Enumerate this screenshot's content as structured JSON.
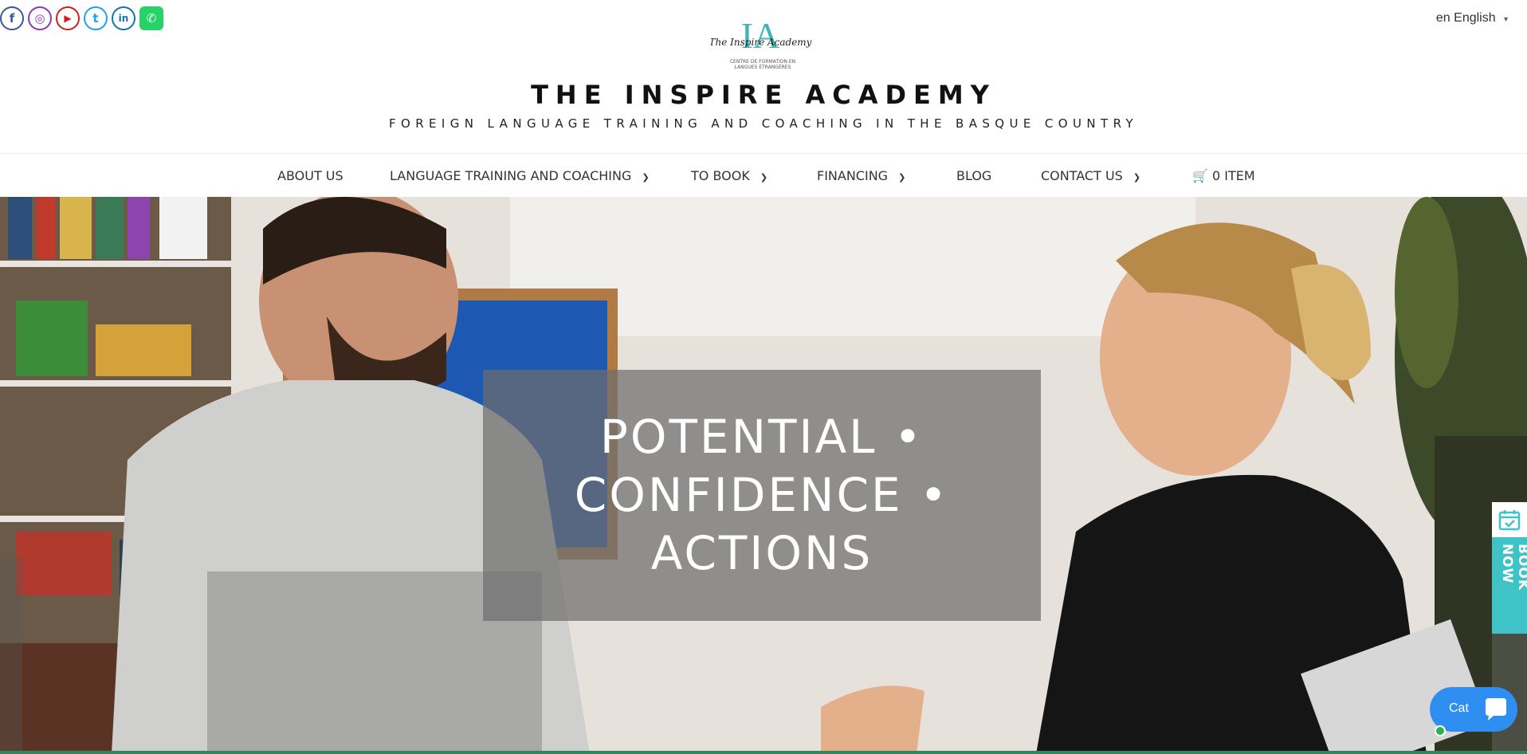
{
  "social": [
    {
      "name": "facebook-icon",
      "glyph": "f"
    },
    {
      "name": "instagram-icon",
      "glyph": "◎"
    },
    {
      "name": "youtube-icon",
      "glyph": "▶"
    },
    {
      "name": "twitter-icon",
      "glyph": "t"
    },
    {
      "name": "linkedin-icon",
      "glyph": "in"
    },
    {
      "name": "whatsapp-icon",
      "glyph": "✆"
    }
  ],
  "language": {
    "code": "en",
    "label": "English"
  },
  "logo": {
    "monogram": "IA",
    "script": "The Inspire Academy",
    "sub_line1": "CENTRE DE FORMATION EN",
    "sub_line2": "LANGUES ÉTRANGÈRES"
  },
  "site": {
    "title": "THE INSPIRE ACADEMY",
    "tagline": "FOREIGN LANGUAGE TRAINING AND COACHING IN THE BASQUE COUNTRY"
  },
  "nav": {
    "about": "ABOUT US",
    "training": "LANGUAGE TRAINING AND COACHING",
    "book": "TO BOOK",
    "financing": "FINANCING",
    "blog": "BLOG",
    "contact": "CONTACT US",
    "cart": "0 ITEM"
  },
  "hero": {
    "line1": "POTENTIAL •",
    "line2": "CONFIDENCE •",
    "line3": "ACTIONS"
  },
  "book_now": {
    "label": "BOOK NOW"
  },
  "chat": {
    "label": "Cat"
  },
  "colors": {
    "accent_teal": "#3fc3c7",
    "chat_blue": "#2f8ff0",
    "whatsapp_green": "#25d366"
  }
}
